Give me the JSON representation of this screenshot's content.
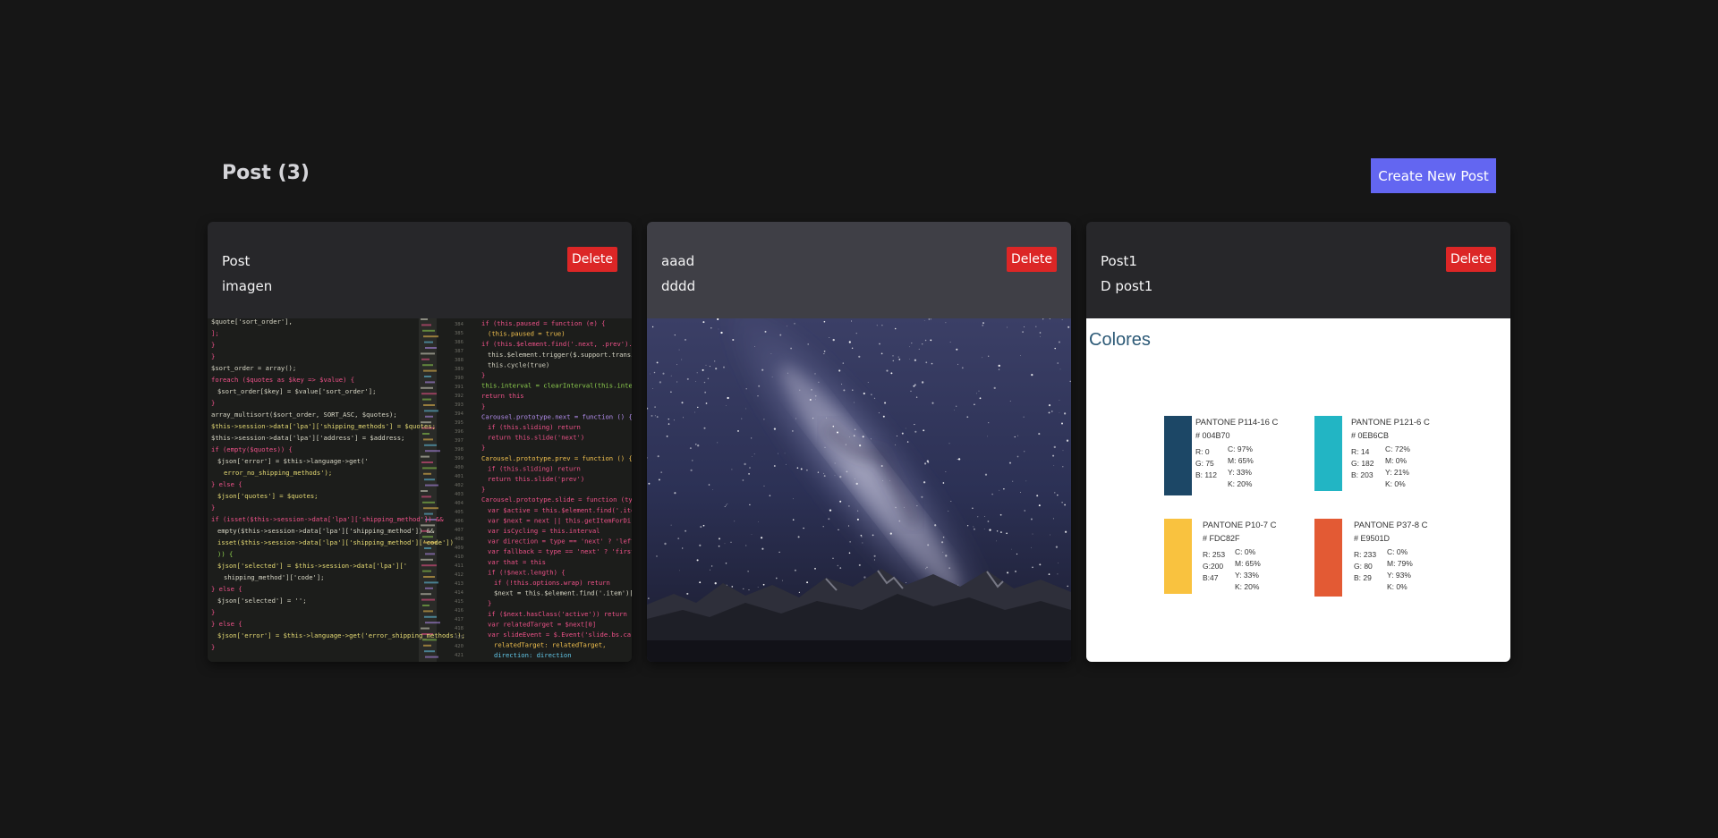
{
  "header": {
    "title": "Post (3)",
    "create_button": "Create New Post"
  },
  "posts": [
    {
      "title": "Post",
      "description": "imagen",
      "delete_label": "Delete",
      "image": "code-editor-screenshot",
      "code_lines_left": [
        "$quote['sort_order'],",
        "];",
        "}",
        "}",
        "$sort_order = array();",
        "foreach ($quotes as $key => $value) {",
        "  $sort_order[$key] = $value['sort_order'];",
        "}",
        "array_multisort($sort_order, SORT_ASC, $quotes);",
        "$this->session->data['lpa']['shipping_methods'] = $quotes;",
        "$this->session->data['lpa']['address'] = $address;",
        "if (empty($quotes)) {",
        "  $json['error'] = $this->language->get('",
        "    error_no_shipping_methods');",
        "} else {",
        "  $json['quotes'] = $quotes;",
        "}",
        "if (isset($this->session->data['lpa']['shipping_method']) &&",
        "  empty($this->session->data['lpa']['shipping_method']) &&",
        "  isset($this->session->data['lpa']['shipping_method']['code'])",
        "  )) {",
        "  $json['selected'] = $this->session->data['lpa']['",
        "    shipping_method']['code'];",
        "} else {",
        "  $json['selected'] = '';",
        "}",
        "} else {",
        "  $json['error'] = $this->language->get('error_shipping_methods');",
        "}"
      ],
      "code_lines_right": [
        "if (this.paused = function (e) {",
        "  (this.paused = true)",
        "if (this.$element.find('.next, .prev').length &&",
        "  this.$element.trigger($.support.transition.end)",
        "  this.cycle(true)",
        "}",
        "this.interval = clearInterval(this.interval)",
        "return this",
        "}",
        "Carousel.prototype.next = function () {",
        "  if (this.sliding) return",
        "  return this.slide('next')",
        "}",
        "Carousel.prototype.prev = function () {",
        "  if (this.sliding) return",
        "  return this.slide('prev')",
        "}",
        "Carousel.prototype.slide = function (type, next) {",
        "  var $active  = this.$element.find('.item.active')",
        "  var $next    = next || this.getItemForDirection",
        "  var isCycling = this.interval",
        "  var direction = type == 'next' ? 'left' : 'right'",
        "  var fallback = type == 'next' ? 'first' : 'last'",
        "  var that     = this",
        "  if (!$next.length) {",
        "    if (!this.options.wrap) return",
        "    $next = this.$element.find('.item')[fallback]()",
        "  }",
        "  if ($next.hasClass('active')) return (this.sliding",
        "  var relatedTarget = $next[0]",
        "  var slideEvent = $.Event('slide.bs.carousel', {",
        "    relatedTarget: relatedTarget,",
        "    direction: direction"
      ],
      "line_numbers": [
        "384",
        "385",
        "386",
        "387",
        "388",
        "389",
        "390",
        "391",
        "392",
        "393",
        "394",
        "395",
        "396",
        "397",
        "398",
        "399",
        "400",
        "401",
        "402",
        "403",
        "404",
        "405",
        "406",
        "407",
        "408",
        "409",
        "410",
        "411",
        "412",
        "413",
        "414",
        "415",
        "416",
        "417",
        "418",
        "419",
        "420",
        "421"
      ]
    },
    {
      "title": "aaad",
      "description": "dddd",
      "delete_label": "Delete",
      "image": "milky-way-night-sky-photo"
    },
    {
      "title": "Post1",
      "description": "D post1",
      "delete_label": "Delete",
      "image": "color-palette-swatches",
      "palette": {
        "heading": "Colores",
        "swatches": [
          {
            "name": "PANTONE P114-16 C",
            "hex": "# 004B70",
            "color": "#1c4766",
            "rgb": [
              "R: 0",
              "G: 75",
              "B: 112"
            ],
            "cmyk": [
              "C: 97%",
              "M: 65%",
              "Y: 33%",
              "K: 20%"
            ]
          },
          {
            "name": "PANTONE P121-6 C",
            "hex": "# 0EB6CB",
            "color": "#22b5c4",
            "rgb": [
              "R: 14",
              "G: 182",
              "B: 203"
            ],
            "cmyk": [
              "C: 72%",
              "M: 0%",
              "Y: 21%",
              "K: 0%"
            ]
          },
          {
            "name": "PANTONE P10-7 C",
            "hex": "# FDC82F",
            "color": "#f9c23f",
            "rgb": [
              "R: 253",
              "G:200",
              "B:47"
            ],
            "cmyk": [
              "C: 0%",
              "M: 65%",
              "Y: 33%",
              "K: 20%"
            ]
          },
          {
            "name": "PANTONE P37-8 C",
            "hex": "# E9501D",
            "color": "#e35a34",
            "rgb": [
              "R: 233",
              "G: 80",
              "B: 29"
            ],
            "cmyk": [
              "C: 0%",
              "M: 79%",
              "Y: 93%",
              "K: 0%"
            ]
          }
        ]
      }
    }
  ],
  "colors": {
    "background": "#161616",
    "card": "#27272a",
    "card_highlight": "#3f3f46",
    "primary": "#6366f1",
    "danger": "#dc2626"
  }
}
